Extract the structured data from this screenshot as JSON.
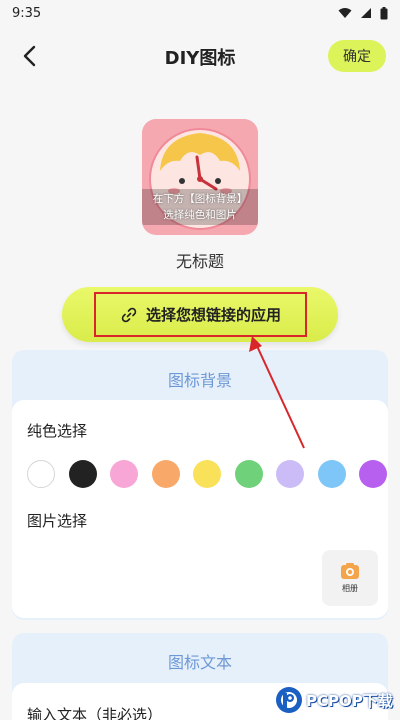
{
  "status_bar": {
    "time": "9:35"
  },
  "nav": {
    "title": "DIY图标",
    "confirm_label": "确定"
  },
  "preview": {
    "hint_line1": "在下方【图标背景】",
    "hint_line2": "选择纯色和图片",
    "label": "无标题"
  },
  "link_button": {
    "label": "选择您想链接的应用"
  },
  "background_section": {
    "title": "图标背景",
    "solid_label": "纯色选择",
    "image_label": "图片选择",
    "album_label": "相册",
    "colors": [
      "#ffffff",
      "#222222",
      "#f7a6d6",
      "#f8a868",
      "#f9e15a",
      "#6fd17a",
      "#cbbcf7",
      "#7ec6f7",
      "#b760f0"
    ]
  },
  "text_section": {
    "title": "图标文本",
    "input_label": "输入文本（非必选）"
  },
  "watermark": {
    "text": "PCPOP下载"
  },
  "colors": {
    "accent": "#ddf35a",
    "panel_bg": "#e6f0fb",
    "panel_title": "#6d98d6",
    "annotation": "#d8262a"
  }
}
